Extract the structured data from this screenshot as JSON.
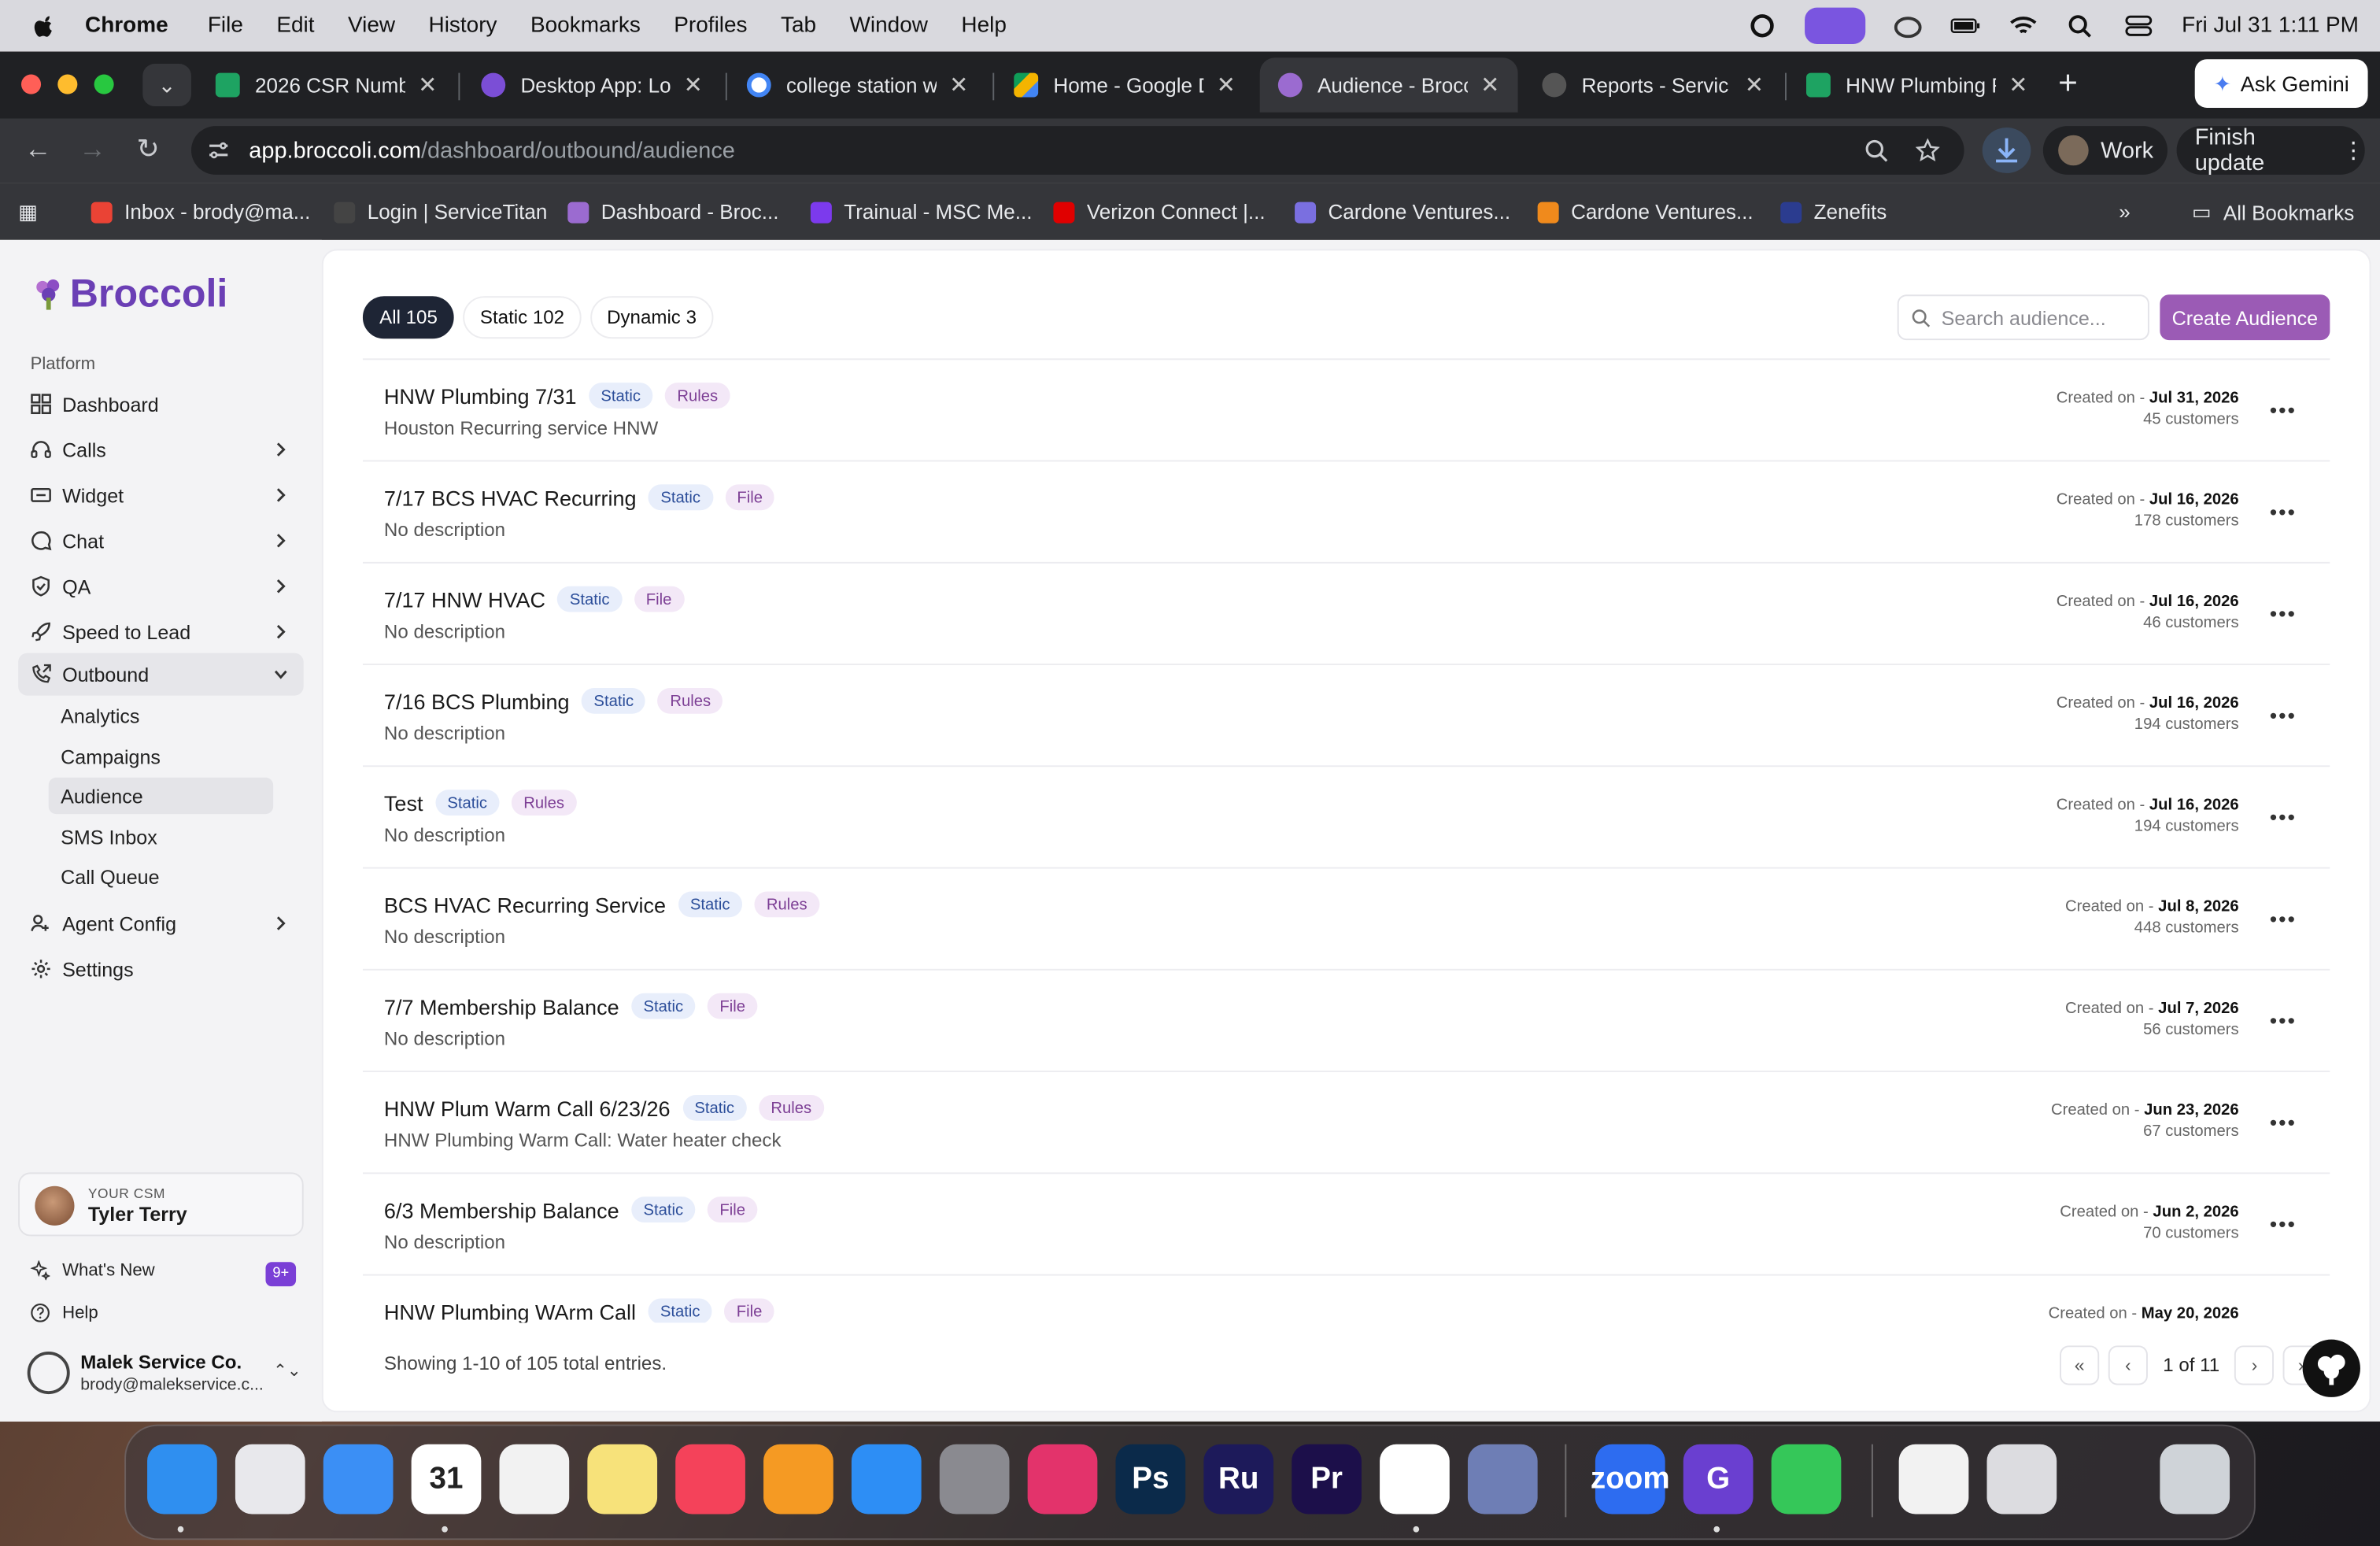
{
  "menubar": {
    "app_name": "Chrome",
    "items": [
      "File",
      "Edit",
      "View",
      "History",
      "Bookmarks",
      "Profiles",
      "Tab",
      "Window",
      "Help"
    ],
    "datetime": "Fri Jul 31  1:11 PM"
  },
  "tabs": [
    {
      "title": "2026 CSR Numbe",
      "icon": "sheets-icon",
      "color": "#1ea362"
    },
    {
      "title": "Desktop App: Log",
      "icon": "g-app-icon",
      "color": "#7b4ed6"
    },
    {
      "title": "college station w",
      "icon": "google-icon",
      "color": "#ffffff"
    },
    {
      "title": "Home - Google D",
      "icon": "drive-icon",
      "color": "#f4b400"
    },
    {
      "title": "Audience - Brocc",
      "icon": "broccoli-icon",
      "color": "#9b6bd0",
      "active": true
    },
    {
      "title": "Reports - Servic",
      "icon": "servicetitan-icon",
      "color": "#555555"
    },
    {
      "title": "HNW Plumbing R",
      "icon": "sheets-icon",
      "color": "#1ea362"
    }
  ],
  "chrome": {
    "ask_gemini": "Ask Gemini",
    "url_host": "app.broccoli.com",
    "url_path": "/dashboard/outbound/audience",
    "profile": "Work",
    "finish_update": "Finish update"
  },
  "bookmarks": [
    {
      "label": "Inbox - brody@ma...",
      "icon": "gmail-icon",
      "color": "#ea4335"
    },
    {
      "label": "Login | ServiceTitan",
      "icon": "servicetitan-icon",
      "color": "#444444"
    },
    {
      "label": "Dashboard - Broc...",
      "icon": "broccoli-icon",
      "color": "#9b6bd0"
    },
    {
      "label": "Trainual - MSC Me...",
      "icon": "trainual-icon",
      "color": "#7c3aed"
    },
    {
      "label": "Verizon Connect |...",
      "icon": "verizon-icon",
      "color": "#e00000"
    },
    {
      "label": "Cardone Ventures...",
      "icon": "cardone-icon",
      "color": "#7a6fe0"
    },
    {
      "label": "Cardone Ventures...",
      "icon": "cardone-b-icon",
      "color": "#f08a1c"
    },
    {
      "label": "Zenefits",
      "icon": "zenefits-icon",
      "color": "#2b3c8f"
    }
  ],
  "all_bookmarks": "All Bookmarks",
  "brand": "Broccoli",
  "sidebar": {
    "section": "Platform",
    "items": [
      {
        "label": "Dashboard",
        "icon": "grid-icon",
        "chevron": false
      },
      {
        "label": "Calls",
        "icon": "headset-icon",
        "chevron": true
      },
      {
        "label": "Widget",
        "icon": "widget-icon",
        "chevron": true
      },
      {
        "label": "Chat",
        "icon": "chat-icon",
        "chevron": true
      },
      {
        "label": "QA",
        "icon": "shield-check-icon",
        "chevron": true
      },
      {
        "label": "Speed to Lead",
        "icon": "rocket-icon",
        "chevron": true
      },
      {
        "label": "Outbound",
        "icon": "phone-out-icon",
        "chevron": true,
        "open": true
      },
      {
        "label": "Agent Config",
        "icon": "agent-icon",
        "chevron": true
      },
      {
        "label": "Settings",
        "icon": "gear-icon",
        "chevron": false
      }
    ],
    "outbound_sub": [
      "Analytics",
      "Campaigns",
      "Audience",
      "SMS Inbox",
      "Call Queue"
    ],
    "csm_label": "YOUR CSM",
    "csm_name": "Tyler Terry",
    "whats_new": "What's New",
    "whats_new_badge": "9+",
    "help": "Help",
    "account_name": "Malek Service Co.",
    "account_email": "brody@malekservice.c..."
  },
  "filters": [
    "All 105",
    "Static 102",
    "Dynamic 3"
  ],
  "search_placeholder": "Search audience...",
  "create_label": "Create Audience",
  "created_prefix": "Created on - ",
  "audiences": [
    {
      "name": "HNW Plumbing 7/31",
      "type": "Static",
      "source": "Rules",
      "desc": "Houston Recurring service HNW",
      "date": "Jul 31, 2026",
      "customers": "45 customers"
    },
    {
      "name": "7/17 BCS HVAC Recurring",
      "type": "Static",
      "source": "File",
      "desc": "No description",
      "date": "Jul 16, 2026",
      "customers": "178 customers"
    },
    {
      "name": "7/17 HNW HVAC",
      "type": "Static",
      "source": "File",
      "desc": "No description",
      "date": "Jul 16, 2026",
      "customers": "46 customers"
    },
    {
      "name": "7/16 BCS Plumbing",
      "type": "Static",
      "source": "Rules",
      "desc": "No description",
      "date": "Jul 16, 2026",
      "customers": "194 customers"
    },
    {
      "name": "Test",
      "type": "Static",
      "source": "Rules",
      "desc": "No description",
      "date": "Jul 16, 2026",
      "customers": "194 customers"
    },
    {
      "name": "BCS HVAC Recurring Service",
      "type": "Static",
      "source": "Rules",
      "desc": "No description",
      "date": "Jul 8, 2026",
      "customers": "448 customers"
    },
    {
      "name": "7/7 Membership Balance",
      "type": "Static",
      "source": "File",
      "desc": "No description",
      "date": "Jul 7, 2026",
      "customers": "56 customers"
    },
    {
      "name": "HNW Plum Warm Call 6/23/26",
      "type": "Static",
      "source": "Rules",
      "desc": "HNW Plumbing Warm Call: Water heater check",
      "date": "Jun 23, 2026",
      "customers": "67 customers"
    },
    {
      "name": "6/3 Membership Balance",
      "type": "Static",
      "source": "File",
      "desc": "No description",
      "date": "Jun 2, 2026",
      "customers": "70 customers"
    },
    {
      "name": "HNW Plumbing WArm Call",
      "type": "Static",
      "source": "File",
      "desc": "",
      "date": "May 20, 2026",
      "customers": ""
    }
  ],
  "footer_text": "Showing 1-10 of 105 total entries.",
  "page_indicator": "1 of 11",
  "dock": [
    {
      "name": "finder-icon",
      "color": "#2f8ff0",
      "label": ""
    },
    {
      "name": "launchpad-icon",
      "color": "#e8e8ec",
      "label": ""
    },
    {
      "name": "mail-icon",
      "color": "#3b8ff5",
      "label": ""
    },
    {
      "name": "calendar-icon",
      "color": "#ffffff",
      "label": "31"
    },
    {
      "name": "photos-icon",
      "color": "#f2f2f2",
      "label": ""
    },
    {
      "name": "notes-icon",
      "color": "#f7e27a",
      "label": ""
    },
    {
      "name": "music-icon",
      "color": "#f4425a",
      "label": ""
    },
    {
      "name": "pages-icon",
      "color": "#f59a23",
      "label": ""
    },
    {
      "name": "app-store-icon",
      "color": "#2d8ef5",
      "label": ""
    },
    {
      "name": "system-settings-icon",
      "color": "#8a8a90",
      "label": ""
    },
    {
      "name": "creative-cloud-icon",
      "color": "#e3336b",
      "label": ""
    },
    {
      "name": "photoshop-icon",
      "color": "#0b2a4a",
      "label": "Ps"
    },
    {
      "name": "rush-icon",
      "color": "#1d1a5a",
      "label": "Ru"
    },
    {
      "name": "premiere-icon",
      "color": "#1c0f4a",
      "label": "Pr"
    },
    {
      "name": "chrome-icon",
      "color": "#ffffff",
      "label": ""
    },
    {
      "name": "simulator-icon",
      "color": "#6e7eb5",
      "label": ""
    },
    {
      "name": "zoom-icon",
      "color": "#2d6cf0",
      "label": "zoom"
    },
    {
      "name": "g-app-icon",
      "color": "#6a3fd0",
      "label": "G"
    },
    {
      "name": "phone-icon",
      "color": "#35c759",
      "label": ""
    },
    {
      "name": "document-icon",
      "color": "#f2f2f2",
      "label": ""
    },
    {
      "name": "screenshot-icon",
      "color": "#dcdce0",
      "label": ""
    },
    {
      "name": "trash-icon",
      "color": "#cfd3d8",
      "label": ""
    }
  ]
}
